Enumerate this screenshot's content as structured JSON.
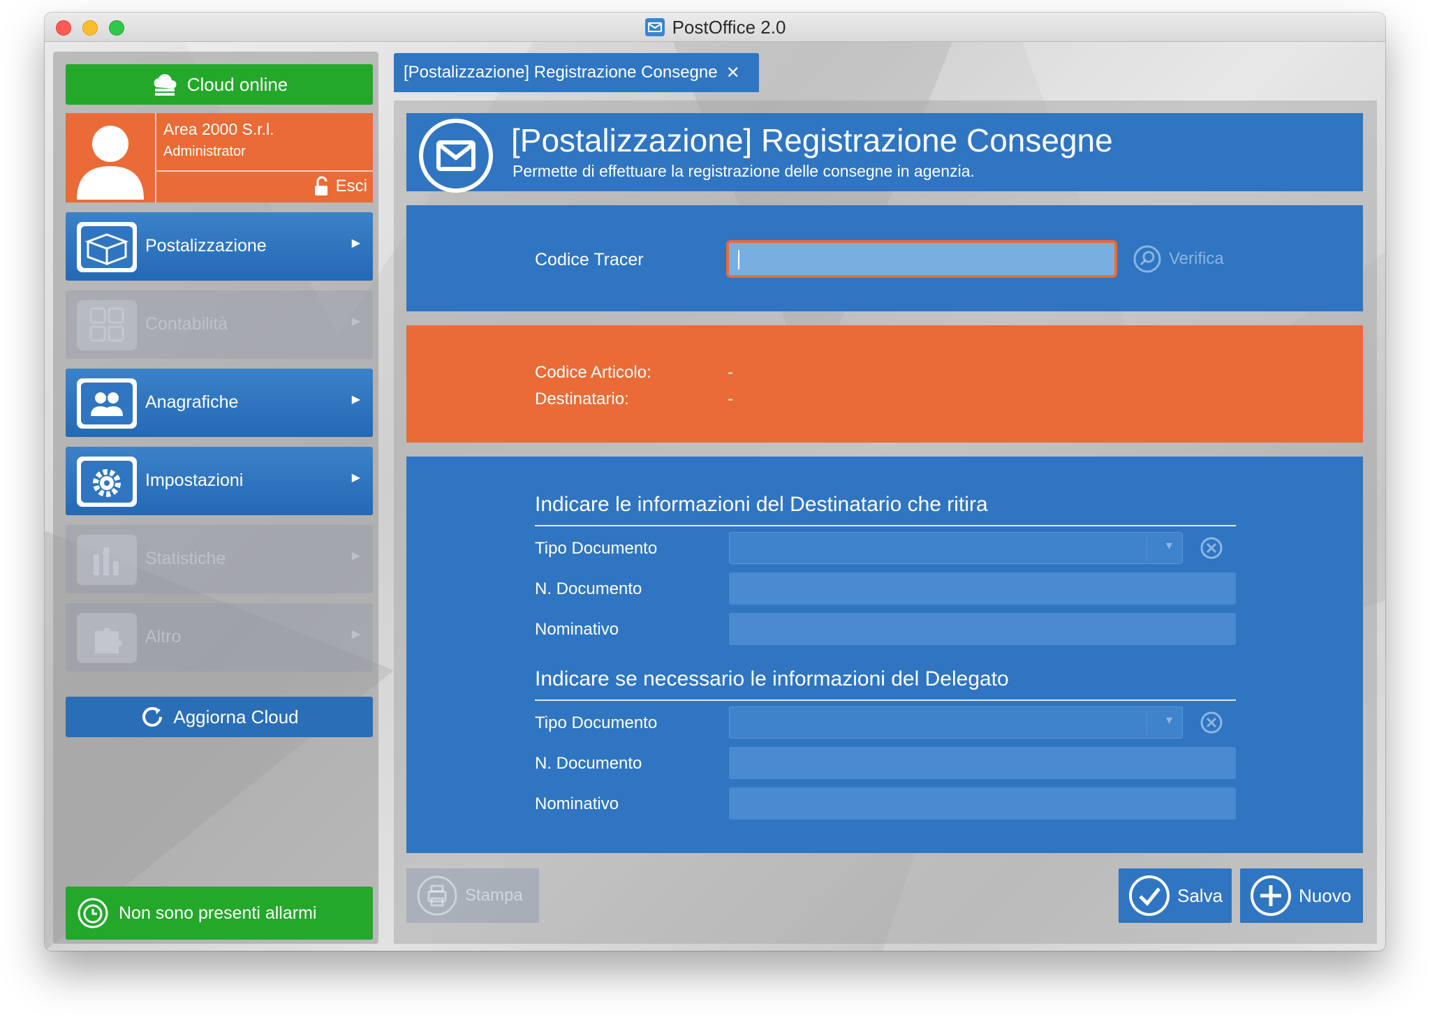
{
  "window": {
    "title": "PostOffice 2.0"
  },
  "sidebar": {
    "cloud_status": "Cloud online",
    "user": {
      "company": "Area 2000 S.r.l.",
      "role": "Administrator",
      "logout_label": "Esci"
    },
    "items": [
      {
        "label": "Postalizzazione",
        "enabled": true
      },
      {
        "label": "Contabilità",
        "enabled": false
      },
      {
        "label": "Anagrafiche",
        "enabled": true
      },
      {
        "label": "Impostazioni",
        "enabled": true
      },
      {
        "label": "Statistiche",
        "enabled": false
      },
      {
        "label": "Altro",
        "enabled": false
      }
    ],
    "refresh_label": "Aggiorna Cloud",
    "alarm_status": "Non sono presenti allarmi"
  },
  "tab": {
    "label": "[Postalizzazione] Registrazione Consegne",
    "close": "✕"
  },
  "header": {
    "title": "[Postalizzazione] Registrazione Consegne",
    "subtitle": "Permette di effettuare la registrazione delle consegne in agenzia."
  },
  "tracer": {
    "label": "Codice Tracer",
    "value": "",
    "verify_label": "Verifica"
  },
  "info": {
    "article_label": "Codice Articolo:",
    "article_value": "-",
    "recipient_label": "Destinatario:",
    "recipient_value": "-"
  },
  "recipient_section": {
    "title": "Indicare le informazioni del Destinatario che ritira",
    "doc_type_label": "Tipo Documento",
    "doc_number_label": "N. Documento",
    "name_label": "Nominativo"
  },
  "delegate_section": {
    "title": "Indicare se necessario le informazioni del Delegato",
    "doc_type_label": "Tipo Documento",
    "doc_number_label": "N. Documento",
    "name_label": "Nominativo"
  },
  "actions": {
    "print_label": "Stampa",
    "save_label": "Salva",
    "new_label": "Nuovo"
  },
  "colors": {
    "accent_blue": "#2f75c2",
    "accent_orange": "#ea6b36",
    "status_green": "#23a82a"
  }
}
